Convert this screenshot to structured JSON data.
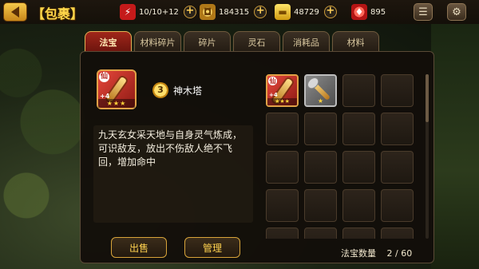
{
  "header": {
    "title": "【包裹】",
    "back_icon": "back-arrow-icon",
    "resources": [
      {
        "name": "energy",
        "icon": "energy-icon",
        "value": "10/10+12"
      },
      {
        "name": "copper",
        "icon": "coin-icon",
        "value": "184315"
      },
      {
        "name": "gold",
        "icon": "gold-ingot-icon",
        "value": "48729"
      },
      {
        "name": "gem",
        "icon": "gem-icon",
        "value": "895"
      }
    ],
    "plus_label": "+",
    "chat_icon": "chat-icon",
    "settings_icon": "gear-icon"
  },
  "tabs": [
    {
      "label": "法宝",
      "active": true
    },
    {
      "label": "材料碎片",
      "active": false
    },
    {
      "label": "碎片",
      "active": false
    },
    {
      "label": "灵石",
      "active": false
    },
    {
      "label": "消耗品",
      "active": false
    },
    {
      "label": "材料",
      "active": false
    }
  ],
  "detail": {
    "item_name": "神木塔",
    "level": "3",
    "enhance": "+4",
    "stars": "★★★",
    "badge": "仙",
    "description": "九天玄女采天地与自身灵气炼成，可识敌友，放出不伤敌人绝不飞回，增加命中",
    "sell_label": "出售",
    "manage_label": "管理"
  },
  "grid": {
    "slot_1": {
      "enhance": "+4",
      "stars": "★★★",
      "badge": "仙"
    },
    "slot_2": {
      "stars": "★"
    }
  },
  "footer": {
    "count_label": "法宝数量",
    "count_value": "2 / 60"
  },
  "colors": {
    "accent_gold": "#ffd24f",
    "tab_active": "#a0261a",
    "panel_bg": "#120e0a"
  }
}
